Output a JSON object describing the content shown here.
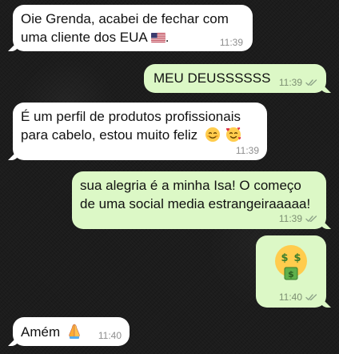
{
  "colors": {
    "background": "#1c1c1c",
    "incoming_bubble": "#ffffff",
    "outgoing_bubble": "#dcf8c6",
    "timestamp_in": "#8e8e8e",
    "timestamp_out": "#7d8f73",
    "read_check": "#8fa58a"
  },
  "messages": [
    {
      "direction": "incoming",
      "lines": [
        "Oie Grenda, acabei de fechar com",
        "uma cliente dos EUA"
      ],
      "emoji": "flag-usa-icon",
      "time": "11:39"
    },
    {
      "direction": "outgoing",
      "lines": [
        "MEU DEUSSSSSS"
      ],
      "time": "11:39",
      "status": "read"
    },
    {
      "direction": "incoming",
      "lines": [
        "É um perfil de produtos profissionais",
        "para cabelo, estou muito feliz"
      ],
      "emoji": [
        "smiling-face-icon",
        "smiling-face-with-hearts-icon"
      ],
      "time": "11:39"
    },
    {
      "direction": "outgoing",
      "lines": [
        "sua alegria é a minha Isa! O começo",
        "de uma social media estrangeiraaaaa!"
      ],
      "time": "11:39",
      "status": "read"
    },
    {
      "direction": "outgoing",
      "emoji": "money-mouth-face-icon",
      "time": "11:40",
      "status": "read"
    },
    {
      "direction": "incoming",
      "lines": [
        "Amém"
      ],
      "emoji": "folded-hands-icon",
      "time": "11:40"
    }
  ]
}
